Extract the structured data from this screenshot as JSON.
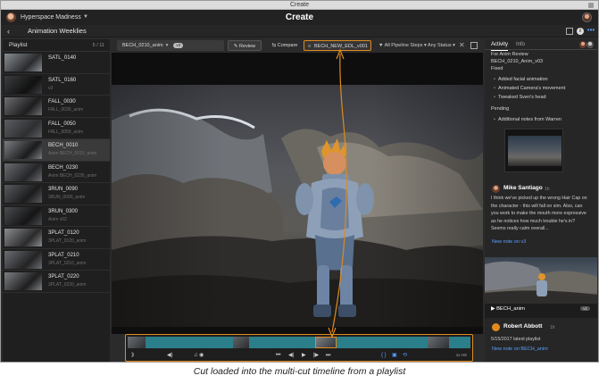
{
  "window": {
    "title": "Create"
  },
  "app": {
    "project": "Hyperspace Madness",
    "title": "Create"
  },
  "page": {
    "back": "‹",
    "title": "Animation Weeklies"
  },
  "playlist": {
    "title": "Playlist",
    "count": "5 / 11",
    "items": [
      {
        "name": "SATL_0140",
        "sub": ""
      },
      {
        "name": "SATL_0160",
        "sub": "v3"
      },
      {
        "name": "FALL_0030",
        "sub": "FALL_0030_anim"
      },
      {
        "name": "FALL_0050",
        "sub": "FALL_0050_anim"
      },
      {
        "name": "BECH_0010",
        "sub": "Anim BECH_0010_anim"
      },
      {
        "name": "BECH_0230",
        "sub": "Anim BECH_0230_anim"
      },
      {
        "name": "3RUN_0090",
        "sub": "3RUN_0090_anim"
      },
      {
        "name": "3RUN_0300",
        "sub": "Anim v02"
      },
      {
        "name": "3PLAT_0120",
        "sub": "3PLAT_0120_anim"
      },
      {
        "name": "3PLAT_0210",
        "sub": "3PLAT_0210_anim"
      },
      {
        "name": "3PLAT_0220",
        "sub": "3PLAT_0220_anim"
      }
    ]
  },
  "toolbar": {
    "shot": "BECH_0210_anim",
    "badge": "v3",
    "review": "✎ Review",
    "compare": "⇆ Compare",
    "cut": "BECH_NEW_EDL_v001",
    "filter": "▼ All Pipeline Steps ▾  Any Status ▾",
    "close": "✕"
  },
  "timeline": {
    "controls": {
      "cast": "⟫",
      "volume": "◀)",
      "audio": "♫ ◉",
      "start": "⏮",
      "prev": "◀|",
      "play": "▶",
      "next": "|▶",
      "end": "⏭",
      "inout": "{ }",
      "cam": "▣",
      "loop": "⟲"
    },
    "zoom": "1x HS"
  },
  "panel": {
    "tabs": [
      "Activity",
      "Info"
    ],
    "note": {
      "lines": [
        "For Anim Review",
        "BECH_0210_Anim_v03",
        "Fixed"
      ],
      "fixed": [
        "Added facial animation",
        "Animated Camera's movement",
        "Tweaked Sven's head"
      ],
      "pending_label": "Pending",
      "pending": [
        "Additional notes from Warren"
      ]
    },
    "comment1": {
      "author": "Mike Santiago",
      "time": "1h",
      "body": "I think we've picked up the wrong Hair Cap on the character - this will fall on sim. Also, can you work to make the mouth more expressive as he notices how much trouble he's in? Seems really calm overall...",
      "link": "New note on v3"
    },
    "card": {
      "label": "▶ BECH_anim",
      "version": "v1"
    },
    "comment2": {
      "initials": "RA",
      "author": "Robert Abbott",
      "time": "1h",
      "body": "5/15/2017 latest playlist",
      "link": "New note on BECH_anim"
    }
  },
  "caption": "Cut loaded into the multi-cut timeline from a playlist",
  "colors": {
    "accent": "#e08a1e",
    "link": "#5aa0ff",
    "bg": "#2b2b2b"
  }
}
